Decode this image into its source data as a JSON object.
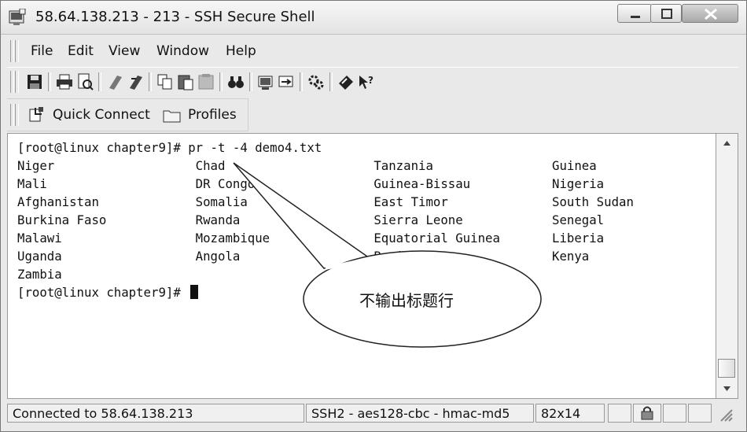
{
  "window": {
    "title": "58.64.138.213 - 213 - SSH Secure Shell",
    "app_icon": "ssh-terminal-icon",
    "controls": [
      "minimize-icon",
      "maximize-icon",
      "close-icon"
    ]
  },
  "menubar": {
    "items": [
      {
        "label": "File"
      },
      {
        "label": "Edit"
      },
      {
        "label": "View"
      },
      {
        "label": "Window"
      },
      {
        "label": "Help"
      }
    ]
  },
  "toolbar": {
    "icons": [
      "save-icon",
      "print-icon",
      "print-preview-icon",
      "disconnect-icon",
      "connect-icon",
      "copy-icon",
      "paste-icon",
      "paste-disabled-icon",
      "find-icon",
      "new-terminal-icon",
      "new-file-transfer-icon",
      "settings-icon",
      "help-icon",
      "context-help-icon"
    ]
  },
  "quickbar": {
    "quick_connect": "Quick Connect",
    "profiles": "Profiles"
  },
  "terminal": {
    "lines": [
      "[root@linux chapter9]# pr -t -4 demo4.txt",
      "Niger                   Chad                    Tanzania                Guinea",
      "Mali                    DR Congo                Guinea-Bissau           Nigeria",
      "Afghanistan             Somalia                 East Timor              South Sudan",
      "Burkina Faso            Rwanda                  Sierra Leone            Senegal",
      "Malawi                  Mozambique              Equatorial Guinea       Liberia",
      "Uganda                  Angola                  Benin                   Kenya",
      "Zambia",
      "[root@linux chapter9]# "
    ]
  },
  "callout": {
    "text": "不输出标题行"
  },
  "statusbar": {
    "connection": "Connected to 58.64.138.213",
    "encryption": "SSH2 - aes128-cbc - hmac-md5",
    "size": "82x14"
  }
}
